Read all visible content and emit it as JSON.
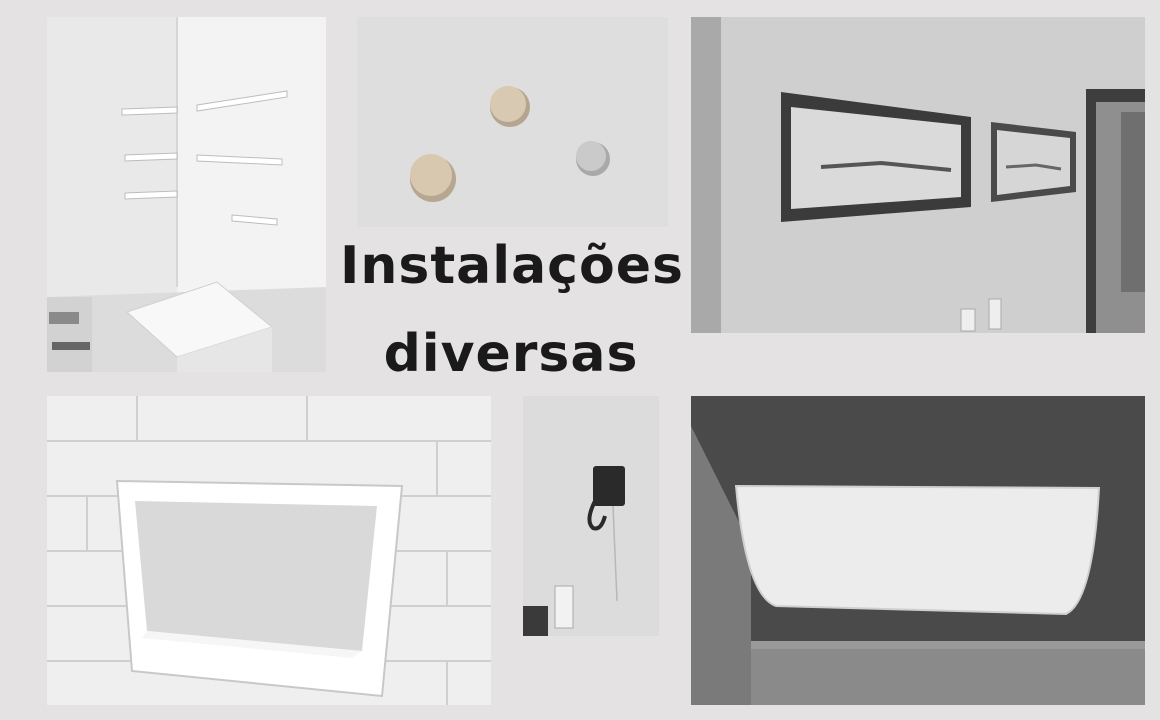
{
  "title": {
    "line1": "Instalações",
    "line2": "diversas"
  },
  "photos": [
    {
      "name": "corner-shelves-photo",
      "subject": "corner floating shelves"
    },
    {
      "name": "wall-knobs-photo",
      "subject": "round wooden wall hooks"
    },
    {
      "name": "framed-pictures-photo",
      "subject": "framed skyline pictures"
    },
    {
      "name": "bathroom-niche-photo",
      "subject": "tiled bathroom niche"
    },
    {
      "name": "wall-hook-photo",
      "subject": "black wall hook"
    },
    {
      "name": "folding-table-photo",
      "subject": "wall-mounted folding table"
    }
  ]
}
